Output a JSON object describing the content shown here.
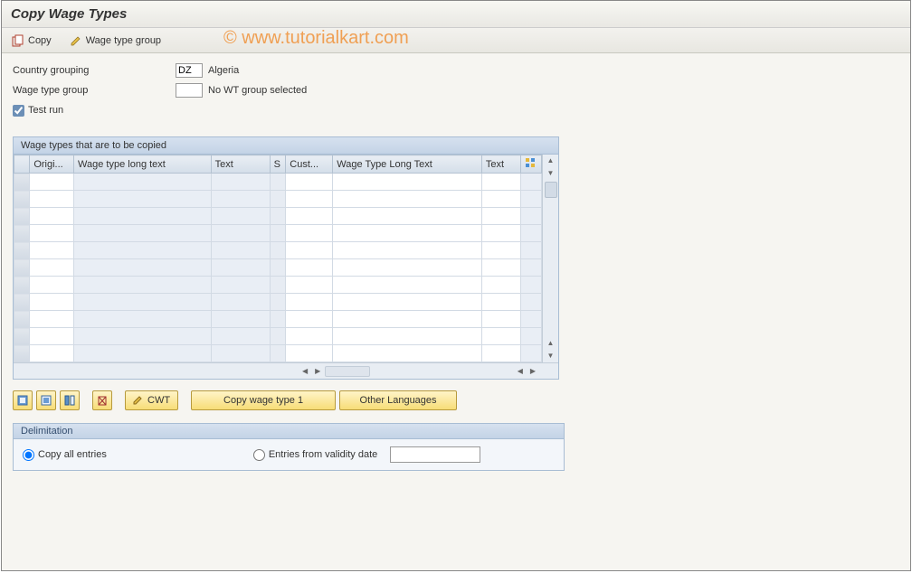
{
  "title": "Copy Wage Types",
  "toolbar": {
    "copy_label": "Copy",
    "wage_group_label": "Wage type group"
  },
  "watermark": "© www.tutorialkart.com",
  "form": {
    "country_label": "Country grouping",
    "country_code": "DZ",
    "country_name": "Algeria",
    "wage_group_label": "Wage type group",
    "wage_group_code": "",
    "wage_group_desc": "No WT group selected",
    "testrun_label": "Test run",
    "testrun_checked": true
  },
  "grid": {
    "title": "Wage types that are to be copied",
    "columns": [
      "Origi...",
      "Wage type long text",
      "Text",
      "S",
      "Cust...",
      "Wage Type Long Text",
      "Text"
    ],
    "row_count": 11
  },
  "action_bar": {
    "cwt_label": "CWT",
    "copy1_label": "Copy wage type 1",
    "otherlang_label": "Other Languages"
  },
  "panel": {
    "title": "Delimitation",
    "copy_all_label": "Copy all entries",
    "entries_from_label": "Entries from validity date",
    "selected": "copy_all"
  }
}
